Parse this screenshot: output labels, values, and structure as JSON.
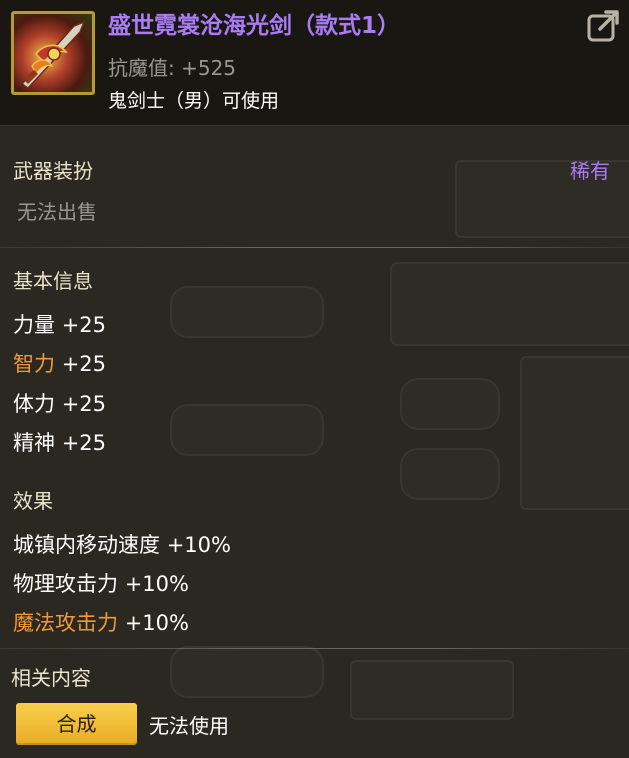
{
  "item": {
    "name": "盛世霓裳沧海光剑（款式1）",
    "magic_resist": "抗魔值: +525",
    "usable_by": "鬼剑士（男）可使用"
  },
  "category": {
    "label": "武器装扮",
    "rarity": "稀有",
    "sell_status": "无法出售"
  },
  "basic_info": {
    "title": "基本信息",
    "stats": [
      {
        "name": "力量",
        "value": "+25",
        "highlight": false
      },
      {
        "name": "智力",
        "value": "+25",
        "highlight": true
      },
      {
        "name": "体力",
        "value": "+25",
        "highlight": false
      },
      {
        "name": "精神",
        "value": "+25",
        "highlight": false
      }
    ]
  },
  "effects": {
    "title": "效果",
    "items": [
      {
        "name": "城镇内移动速度",
        "value": "+10%",
        "highlight": false
      },
      {
        "name": "物理攻击力",
        "value": "+10%",
        "highlight": false
      },
      {
        "name": "魔法攻击力",
        "value": "+10%",
        "highlight": true
      }
    ]
  },
  "related": {
    "title": "相关内容",
    "synthesize_button": "合成",
    "note": "无法使用"
  },
  "colors": {
    "rarity_purple": "#a97cf6",
    "highlight_orange": "#f09a35",
    "button_yellow": "#f0bd36"
  },
  "icons": {
    "item": "sword-costume-icon",
    "share": "share-export-icon"
  }
}
